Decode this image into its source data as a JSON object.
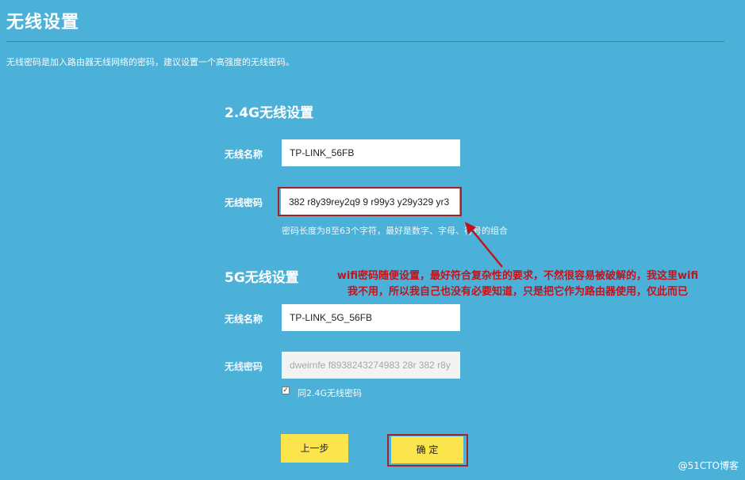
{
  "page": {
    "title": "无线设置",
    "description": "无线密码是加入路由器无线网络的密码，建议设置一个高强度的无线密码。"
  },
  "wifi24": {
    "section_title": "2.4G无线设置",
    "name_label": "无线名称",
    "name_value": "TP-LINK_56FB",
    "password_label": "无线密码",
    "password_value": "382 r8y39rey2q9 9 r99y3 y29y329 yr3",
    "password_hint": "密码长度为8至63个字符，最好是数字、字母、符号的组合"
  },
  "wifi5": {
    "section_title": "5G无线设置",
    "name_label": "无线名称",
    "name_value": "TP-LINK_5G_56FB",
    "password_label": "无线密码",
    "password_value": "dweirnfe f8938243274983 28r 382 r8y",
    "same_password_checked": true,
    "same_password_label": "同2.4G无线密码"
  },
  "buttons": {
    "prev_label": "上一步",
    "confirm_label": "确 定"
  },
  "annotation": {
    "line1": "wifi密码随便设置，最好符合复杂性的要求，不然很容易被破解的，我这里wifi",
    "line2": "我不用，所以我自己也没有必要知道，只是把它作为路由器使用，仅此而已"
  },
  "watermark": "@51CTO博客",
  "colors": {
    "background": "#4cb1d8",
    "button": "#fbe44c",
    "annotation": "#c0141c"
  }
}
